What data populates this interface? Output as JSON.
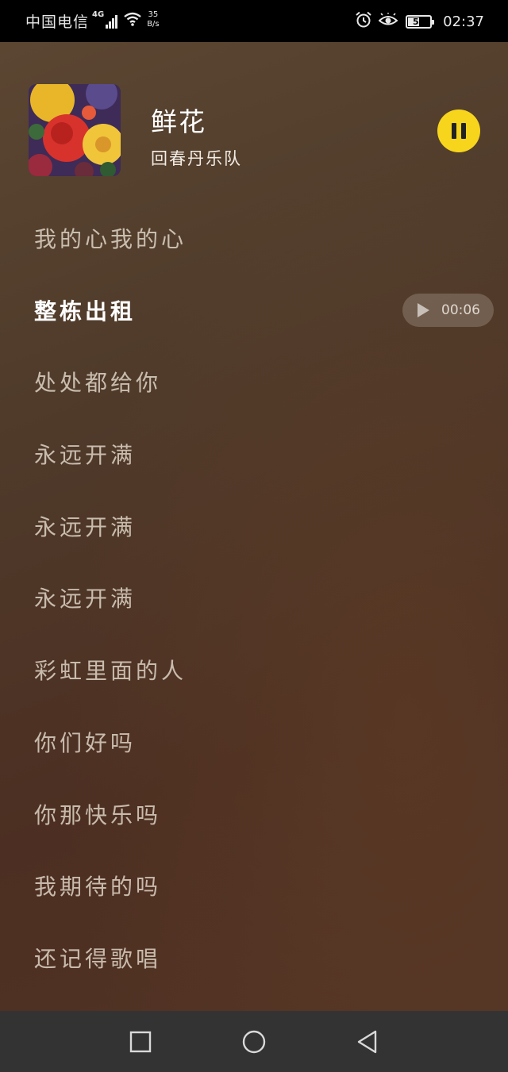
{
  "status_bar": {
    "carrier": "中国电信",
    "network": "4G",
    "speed_value": "35",
    "speed_unit": "B/s",
    "battery": "52",
    "battery_fraction": 0.52,
    "time": "02:37"
  },
  "now_playing": {
    "title": "鲜花",
    "artist": "回春丹乐队",
    "state": "playing"
  },
  "lyrics": [
    {
      "text": "我的心我的心",
      "active": false
    },
    {
      "text": "整栋出租",
      "active": true
    },
    {
      "text": "处处都给你",
      "active": false
    },
    {
      "text": "永远开满",
      "active": false
    },
    {
      "text": "永远开满",
      "active": false
    },
    {
      "text": "永远开满",
      "active": false
    },
    {
      "text": "彩虹里面的人",
      "active": false
    },
    {
      "text": "你们好吗",
      "active": false
    },
    {
      "text": "你那快乐吗",
      "active": false
    },
    {
      "text": "我期待的吗",
      "active": false
    },
    {
      "text": "还记得歌唱",
      "active": false
    }
  ],
  "seek": {
    "time": "00:06"
  },
  "colors": {
    "accent": "#f7d51c",
    "background_top": "#5b4632",
    "background_bottom": "#523324",
    "nav_bar": "#333333"
  },
  "icons": {
    "pause": "pause-icon",
    "seek_play": "play-icon",
    "nav_recents": "square-icon",
    "nav_home": "circle-icon",
    "nav_back": "triangle-back-icon"
  }
}
